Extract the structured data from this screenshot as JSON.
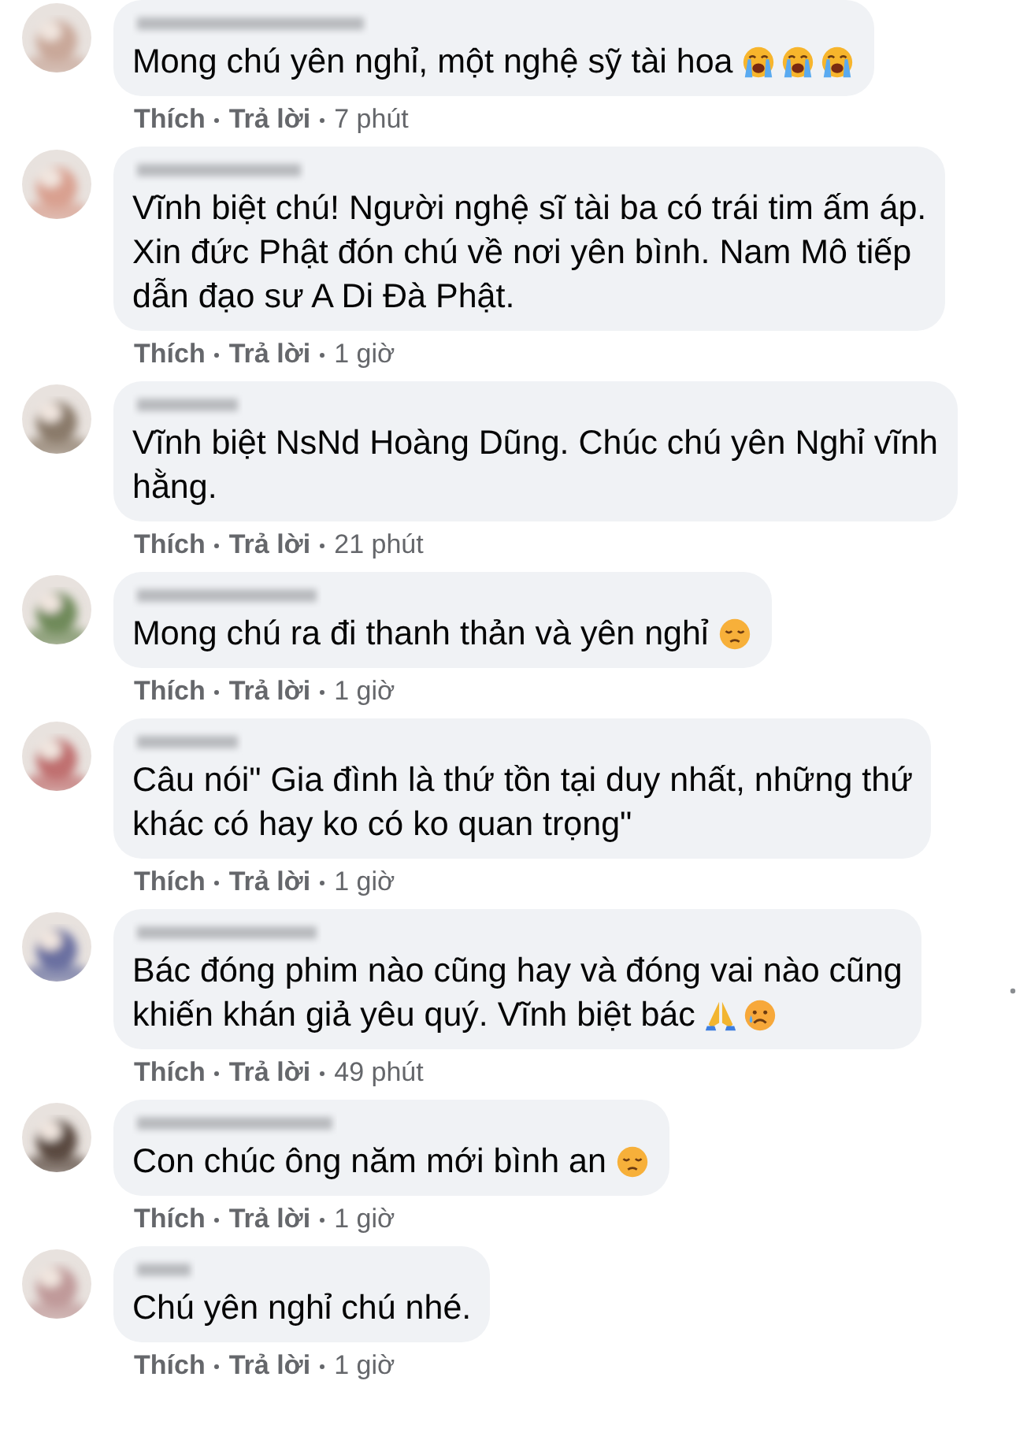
{
  "comments": [
    {
      "lines": [
        "Mong chú yên nghỉ, một nghệ sỹ tài hoa"
      ],
      "emojis": [
        {
          "kind": "sob"
        },
        {
          "kind": "sob"
        },
        {
          "kind": "sob"
        }
      ],
      "like": "Thích",
      "reply": "Trả lời",
      "time": "7 phút",
      "menu_visible": false
    },
    {
      "lines": [
        "Vĩnh biệt chú! Người nghệ sĩ tài ba có trái tim ấm áp.",
        "Xin đức Phật đón chú về nơi yên bình. Nam Mô tiếp",
        "dẫn đạo sư A Di Đà Phật."
      ],
      "like": "Thích",
      "reply": "Trả lời",
      "time": "1 giờ",
      "menu_visible": false
    },
    {
      "lines": [
        "Vĩnh biệt NsNd Hoàng Dũng. Chúc chú yên Nghỉ vĩnh",
        "hằng."
      ],
      "like": "Thích",
      "reply": "Trả lời",
      "time": "21 phút",
      "menu_visible": false
    },
    {
      "lines": [
        "Mong chú ra đi thanh thản và yên nghỉ"
      ],
      "emojis": [
        {
          "kind": "pensive"
        }
      ],
      "like": "Thích",
      "reply": "Trả lời",
      "time": "1 giờ",
      "menu_visible": false
    },
    {
      "lines": [
        "Câu nói\" Gia đình là thứ tồn tại duy nhất, những thứ",
        "khác có hay ko có ko quan trọng\""
      ],
      "like": "Thích",
      "reply": "Trả lời",
      "time": "1 giờ",
      "menu_visible": false
    },
    {
      "lines": [
        "Bác đóng phim nào cũng hay và đóng vai nào cũng",
        "khiến khán giả yêu quý. Vĩnh biệt bác"
      ],
      "emojis": [
        {
          "kind": "pray"
        },
        {
          "kind": "cry"
        }
      ],
      "like": "Thích",
      "reply": "Trả lời",
      "time": "49 phút",
      "menu_visible": true
    },
    {
      "lines": [
        "Con chúc ông năm mới bình an"
      ],
      "emojis": [
        {
          "kind": "pensive"
        }
      ],
      "like": "Thích",
      "reply": "Trả lời",
      "time": "1 giờ",
      "menu_visible": false
    },
    {
      "lines": [
        "Chú yên nghỉ chú nhé."
      ],
      "like": "Thích",
      "reply": "Trả lời",
      "time": "1 giờ",
      "menu_visible": false
    }
  ]
}
